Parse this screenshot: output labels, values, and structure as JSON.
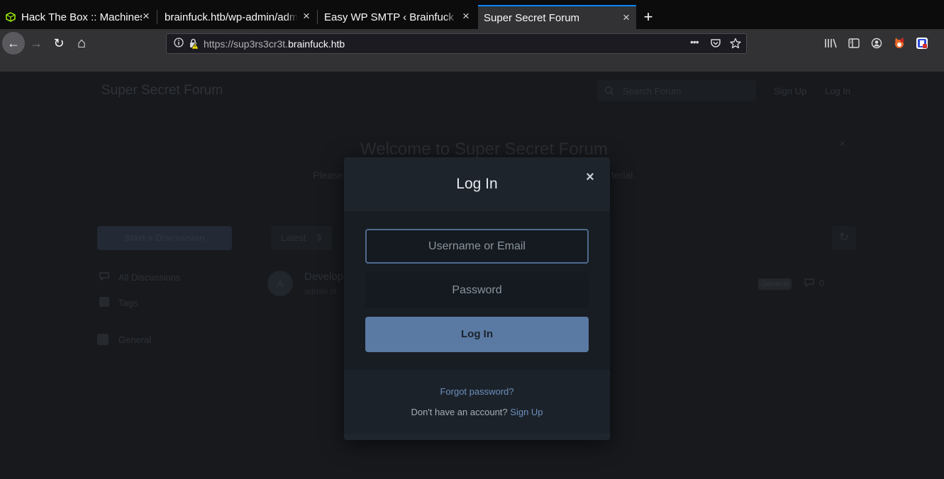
{
  "browser": {
    "tabs": [
      {
        "title": "Hack The Box :: Machines"
      },
      {
        "title": "brainfuck.htb/wp-admin/admin"
      },
      {
        "title": "Easy WP SMTP ‹ Brainfuck Ltd"
      },
      {
        "title": "Super Secret Forum"
      }
    ],
    "url_prefix": "https://sup3rs3cr3t.",
    "url_host": "brainfuck.htb",
    "icons": {
      "close": "×",
      "new_tab": "+",
      "back": "←",
      "forward": "→",
      "reload": "↻",
      "home": "⌂",
      "more": "•••"
    }
  },
  "forum": {
    "title": "Super Secret Forum",
    "search_placeholder": "Search Forum",
    "signup": "Sign Up",
    "login": "Log In",
    "hero_title": "Welcome to Super Secret Forum",
    "hero_text": "Please",
    "hero_tail": "terial.",
    "start_discussion": "Start a Discussion",
    "nav_all": "All Discussions",
    "nav_tags": "Tags",
    "nav_general": "General",
    "sort": "Latest",
    "discussion_title": "Develop",
    "discussion_meta": "admin st",
    "avatar_letter": "A",
    "tag": "General",
    "replies": "0"
  },
  "modal": {
    "title": "Log In",
    "close": "×",
    "username_placeholder": "Username or Email",
    "password_placeholder": "Password",
    "submit": "Log In",
    "forgot": "Forgot password?",
    "no_account": "Don't have an account?",
    "signup": "Sign Up"
  },
  "colors": {
    "accent": "#0a84ff",
    "button": "#5a7aa3",
    "link": "#6b8fbf"
  }
}
